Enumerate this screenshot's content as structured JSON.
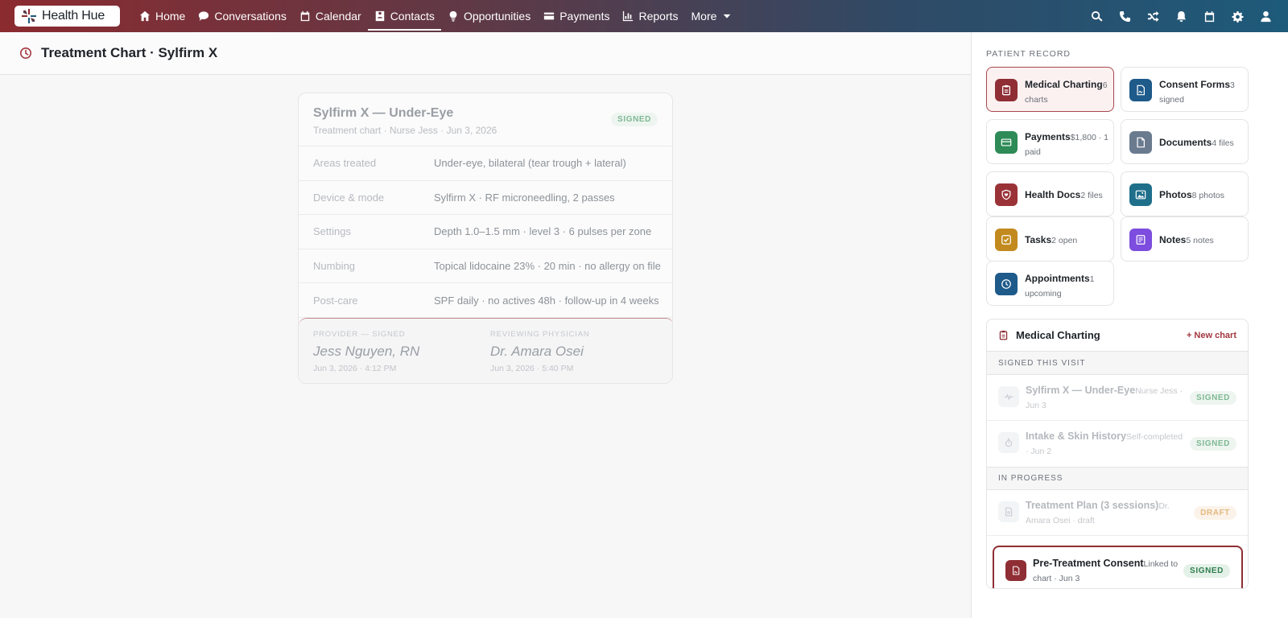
{
  "app": {
    "name": "Health Hue"
  },
  "nav": {
    "items": [
      {
        "label": "Home",
        "icon": "home-icon"
      },
      {
        "label": "Conversations",
        "icon": "chat-icon"
      },
      {
        "label": "Calendar",
        "icon": "calendar-icon"
      },
      {
        "label": "Contacts",
        "icon": "contact-card-icon",
        "active": true
      },
      {
        "label": "Opportunities",
        "icon": "lightbulb-icon"
      },
      {
        "label": "Payments",
        "icon": "credit-card-icon"
      },
      {
        "label": "Reports",
        "icon": "bar-chart-icon"
      },
      {
        "label": "More",
        "icon": "chevron-down-icon"
      }
    ],
    "right_icons": [
      "search-icon",
      "phone-icon",
      "shuffle-icon",
      "bell-icon",
      "calendar-icon",
      "gear-icon",
      "user-icon"
    ]
  },
  "page": {
    "title": "Treatment Chart · Sylfirm X"
  },
  "chart": {
    "title": "Sylfirm X — Under-Eye",
    "subtitle": "Treatment chart · Nurse Jess · Jun 3, 2026",
    "status": "SIGNED",
    "rows": [
      {
        "label": "Areas treated",
        "value": "Under-eye, bilateral (tear trough + lateral)"
      },
      {
        "label": "Device & mode",
        "value": "Sylfirm X · RF microneedling, 2 passes"
      },
      {
        "label": "Settings",
        "value": "Depth 1.0–1.5 mm · level 3 · 6 pulses per zone"
      },
      {
        "label": "Numbing",
        "value": "Topical lidocaine 23% · 20 min · no allergy on file"
      },
      {
        "label": "Post-care",
        "value": "SPF daily · no actives 48h · follow-up in 4 weeks"
      }
    ],
    "provider": {
      "caption": "PROVIDER — SIGNED",
      "name": "Jess Nguyen, RN",
      "date": "Jun 3, 2026 · 4:12 PM"
    },
    "physician": {
      "caption": "REVIEWING PHYSICIAN",
      "name": "Dr. Amara Osei",
      "date": "Jun 3, 2026 · 5:40 PM"
    }
  },
  "record": {
    "caption": "PATIENT RECORD",
    "tiles": [
      {
        "name": "Medical Charting",
        "meta": "6 charts",
        "color": "#8f2e34",
        "icon": "clipboard-icon",
        "active": true
      },
      {
        "name": "Consent Forms",
        "meta": "3 signed",
        "color": "#1e5a8a",
        "icon": "file-signature-icon"
      },
      {
        "name": "Payments",
        "meta": "$1,800 · 1 paid",
        "color": "#2e8b57",
        "icon": "credit-card-icon"
      },
      {
        "name": "Documents",
        "meta": "4 files",
        "color": "#6b7b8f",
        "icon": "document-icon"
      },
      {
        "name": "Health Docs",
        "meta": "2 files",
        "color": "#9a3338",
        "icon": "heart-shield-icon"
      },
      {
        "name": "Photos",
        "meta": "8 photos",
        "color": "#1f6f8b",
        "icon": "image-icon"
      },
      {
        "name": "Tasks",
        "meta": "2 open",
        "color": "#c28a1e",
        "icon": "checkbox-icon"
      },
      {
        "name": "Notes",
        "meta": "5 notes",
        "color": "#7c4dde",
        "icon": "note-icon"
      },
      {
        "name": "Appointments",
        "meta": "1 upcoming",
        "color": "#1e5a8a",
        "icon": "clock-icon"
      }
    ]
  },
  "charting": {
    "title": "Medical Charting",
    "new_label": "+ New chart",
    "signed_section": "SIGNED THIS VISIT",
    "progress_section": "IN PROGRESS",
    "signed_items": [
      {
        "name": "Sylfirm X — Under-Eye",
        "meta": "Nurse Jess · Jun 3",
        "status": "SIGNED"
      },
      {
        "name": "Intake & Skin History",
        "meta": "Self-completed · Jun 2",
        "status": "SIGNED"
      }
    ],
    "progress_items": [
      {
        "name": "Treatment Plan (3 sessions)",
        "meta": "Dr. Amara Osei · draft",
        "status": "DRAFT"
      }
    ],
    "highlight": {
      "name": "Pre-Treatment Consent",
      "meta": "Linked to chart · Jun 3",
      "status": "SIGNED"
    }
  }
}
